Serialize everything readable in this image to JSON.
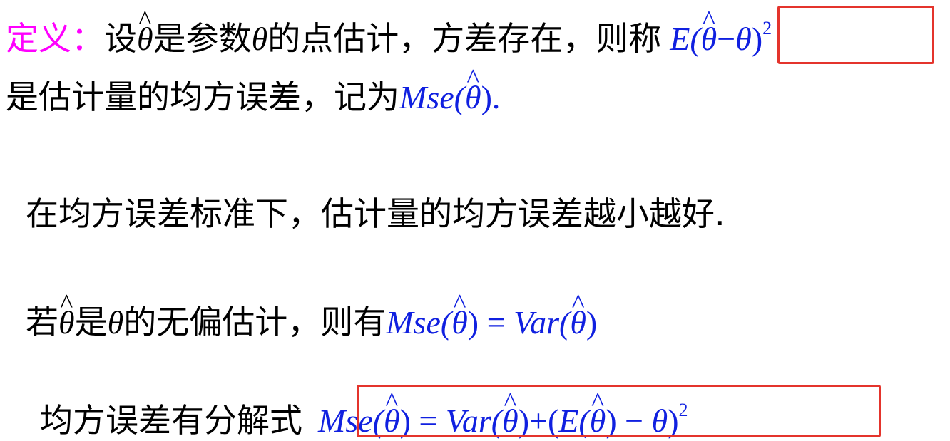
{
  "definition": {
    "label": "定义：",
    "t1": "设",
    "t2": "是参数",
    "t3": "的点估计，方差存在，则称",
    "t4": "是估计量的均方误差，记为",
    "hat_symbol": "^",
    "theta": "θ",
    "expr_E": "E(",
    "expr_minus": "−",
    "expr_close": ")",
    "expr_sup": "2",
    "mse_name": "Mse(",
    "mse_close": ")."
  },
  "criterion": {
    "text": "在均方误差标准下，估计量的均方误差越小越好."
  },
  "unbiased": {
    "t1": "若",
    "t2": "是",
    "t3": "的无偏估计，则有",
    "mse": "Mse(",
    "close": ")",
    "eq": " = ",
    "var": "Var(",
    "close2": ")"
  },
  "decomposition": {
    "label": "均方误差有分解式",
    "mse": "Mse(",
    "close": ")",
    "eq": " = ",
    "var": "Var(",
    "plus": ")+(",
    "E": "E(",
    "minus": ") − ",
    "close_final": ")",
    "sup": "2"
  },
  "colors": {
    "label_magenta": "#ff00ff",
    "math_blue": "#1020e0",
    "box_red": "#e4342c"
  }
}
